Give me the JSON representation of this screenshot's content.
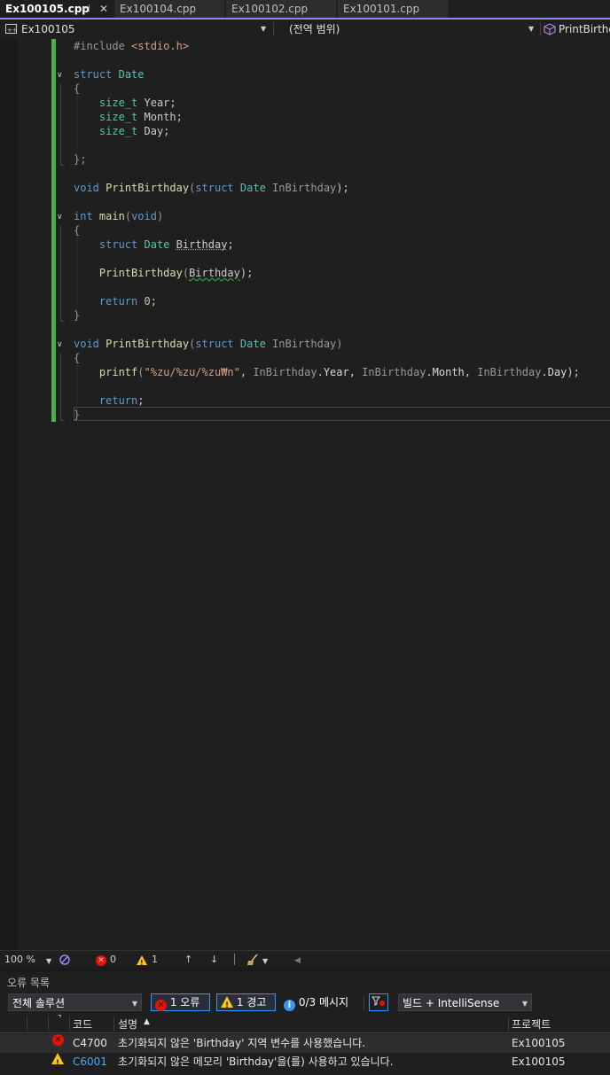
{
  "tabs": [
    {
      "label": "Ex100105.cpp",
      "active": true,
      "pin": "⊣",
      "close": "✕"
    },
    {
      "label": "Ex100104.cpp",
      "active": false
    },
    {
      "label": "Ex100102.cpp",
      "active": false
    },
    {
      "label": "Ex100101.cpp",
      "active": false
    }
  ],
  "navbar": {
    "project": "Ex100105",
    "scope": "(전역 범위)",
    "member": "PrintBirthday"
  },
  "code": {
    "l1": {
      "pre": "#include ",
      "inc": "<stdio.h>"
    },
    "l3": {
      "kw": "struct",
      "name": "Date"
    },
    "brace_open": "{",
    "brace_close": "}",
    "brace_close_semi": "};",
    "field_type": "size_t",
    "fields": [
      "Year;",
      "Month;",
      "Day;"
    ],
    "decl": {
      "kw_void": "void",
      "fn": "PrintBirthday",
      "kw_struct": "struct",
      "type": "Date",
      "param": "InBirthday",
      "end": ");"
    },
    "main": {
      "kw_int": "int",
      "fn": "main",
      "kw_void": "void"
    },
    "local": {
      "kw_struct": "struct",
      "type": "Date",
      "var": "Birthday",
      "end": ";"
    },
    "call": {
      "fn": "PrintBirthday",
      "arg": "Birthday",
      "end": ");"
    },
    "ret0": {
      "kw": "return",
      "num": "0",
      "end": ";"
    },
    "def": {
      "kw_void": "void",
      "fn": "PrintBirthday",
      "kw_struct": "struct",
      "type": "Date",
      "param": "InBirthday",
      "end": ")"
    },
    "printf": {
      "fn": "printf",
      "fmt": "\"%zu/%zu/%zu₩n\"",
      "a1": "InBirthday",
      "m1": "Year",
      "a2": "InBirthday",
      "m2": "Month",
      "a3": "InBirthday",
      "m3": "Day",
      "end": ");"
    },
    "ret": {
      "kw": "return",
      "end": ";"
    }
  },
  "status": {
    "zoom": "100 %",
    "errors": "0",
    "warnings": "1",
    "up": "↑",
    "down": "↓"
  },
  "error_list": {
    "title": "오류 목록",
    "scope": "전체 솔루션",
    "errors_btn": "1 오류",
    "warnings_btn": "1 경고",
    "messages_btn": "0/3 메시지",
    "source": "빌드 + IntelliSense",
    "columns": {
      "code": "코드",
      "desc": "설명",
      "project": "프로젝트"
    },
    "rows": [
      {
        "severity": "error",
        "code": "C4700",
        "desc": "초기화되지 않은 'Birthday' 지역 변수를 사용했습니다.",
        "project": "Ex100105"
      },
      {
        "severity": "warning",
        "code": "C6001",
        "desc": "초기화되지 않은 메모리 'Birthday'을(를) 사용하고 있습니다.",
        "project": "Ex100105"
      }
    ]
  },
  "colors": {
    "accent": "#9184ee",
    "change_bar": "#4caf50",
    "error": "#e51400",
    "warning": "#f5c518",
    "info": "#3794ff"
  }
}
